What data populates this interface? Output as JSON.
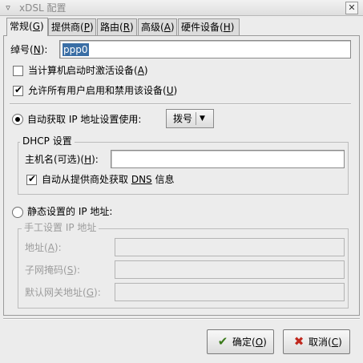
{
  "window": {
    "title": "xDSL 配置",
    "menu_icon": "▿",
    "close_icon": "✕"
  },
  "tabs": [
    {
      "label": "常规",
      "mnemonic": "G"
    },
    {
      "label": "提供商",
      "mnemonic": "P"
    },
    {
      "label": "路由",
      "mnemonic": "R"
    },
    {
      "label": "高级",
      "mnemonic": "A"
    },
    {
      "label": "硬件设备",
      "mnemonic": "H"
    }
  ],
  "general": {
    "nickname_label": "绰号",
    "nickname_mnemonic": "N",
    "nickname_value": "ppp0",
    "activate_on_boot": {
      "label": "当计算机启动时激活设备",
      "mnemonic": "A",
      "checked": false
    },
    "allow_users": {
      "label": "允许所有用户启用和禁用该设备",
      "mnemonic": "U",
      "checked": true
    },
    "auto_ip": {
      "label": "自动获取 IP 地址设置使用:",
      "selected": true,
      "method_value": "拨号",
      "arrow": "▼"
    },
    "dhcp": {
      "group_title": "DHCP 设置",
      "hostname_label": "主机名(可选)",
      "hostname_mnemonic": "H",
      "hostname_value": "",
      "auto_dns": {
        "label_prefix": "自动从提供商处获取 ",
        "dns_text": "DNS",
        "label_suffix": " 信息",
        "checked": true
      }
    },
    "static_ip": {
      "label": "静态设置的 IP 地址:",
      "selected": false,
      "group_title": "手工设置 IP 地址",
      "address_label": "地址",
      "address_mnemonic": "A",
      "address_value": "",
      "subnet_label": "子网掩码",
      "subnet_mnemonic": "S",
      "subnet_value": "",
      "gateway_label": "默认网关地址",
      "gateway_mnemonic": "G",
      "gateway_value": ""
    }
  },
  "buttons": {
    "ok": {
      "label": "确定",
      "mnemonic": "O",
      "icon": "✔",
      "color": "#3a7a1a"
    },
    "cancel": {
      "label": "取消",
      "mnemonic": "C",
      "icon": "✖",
      "color": "#c0281e"
    }
  }
}
